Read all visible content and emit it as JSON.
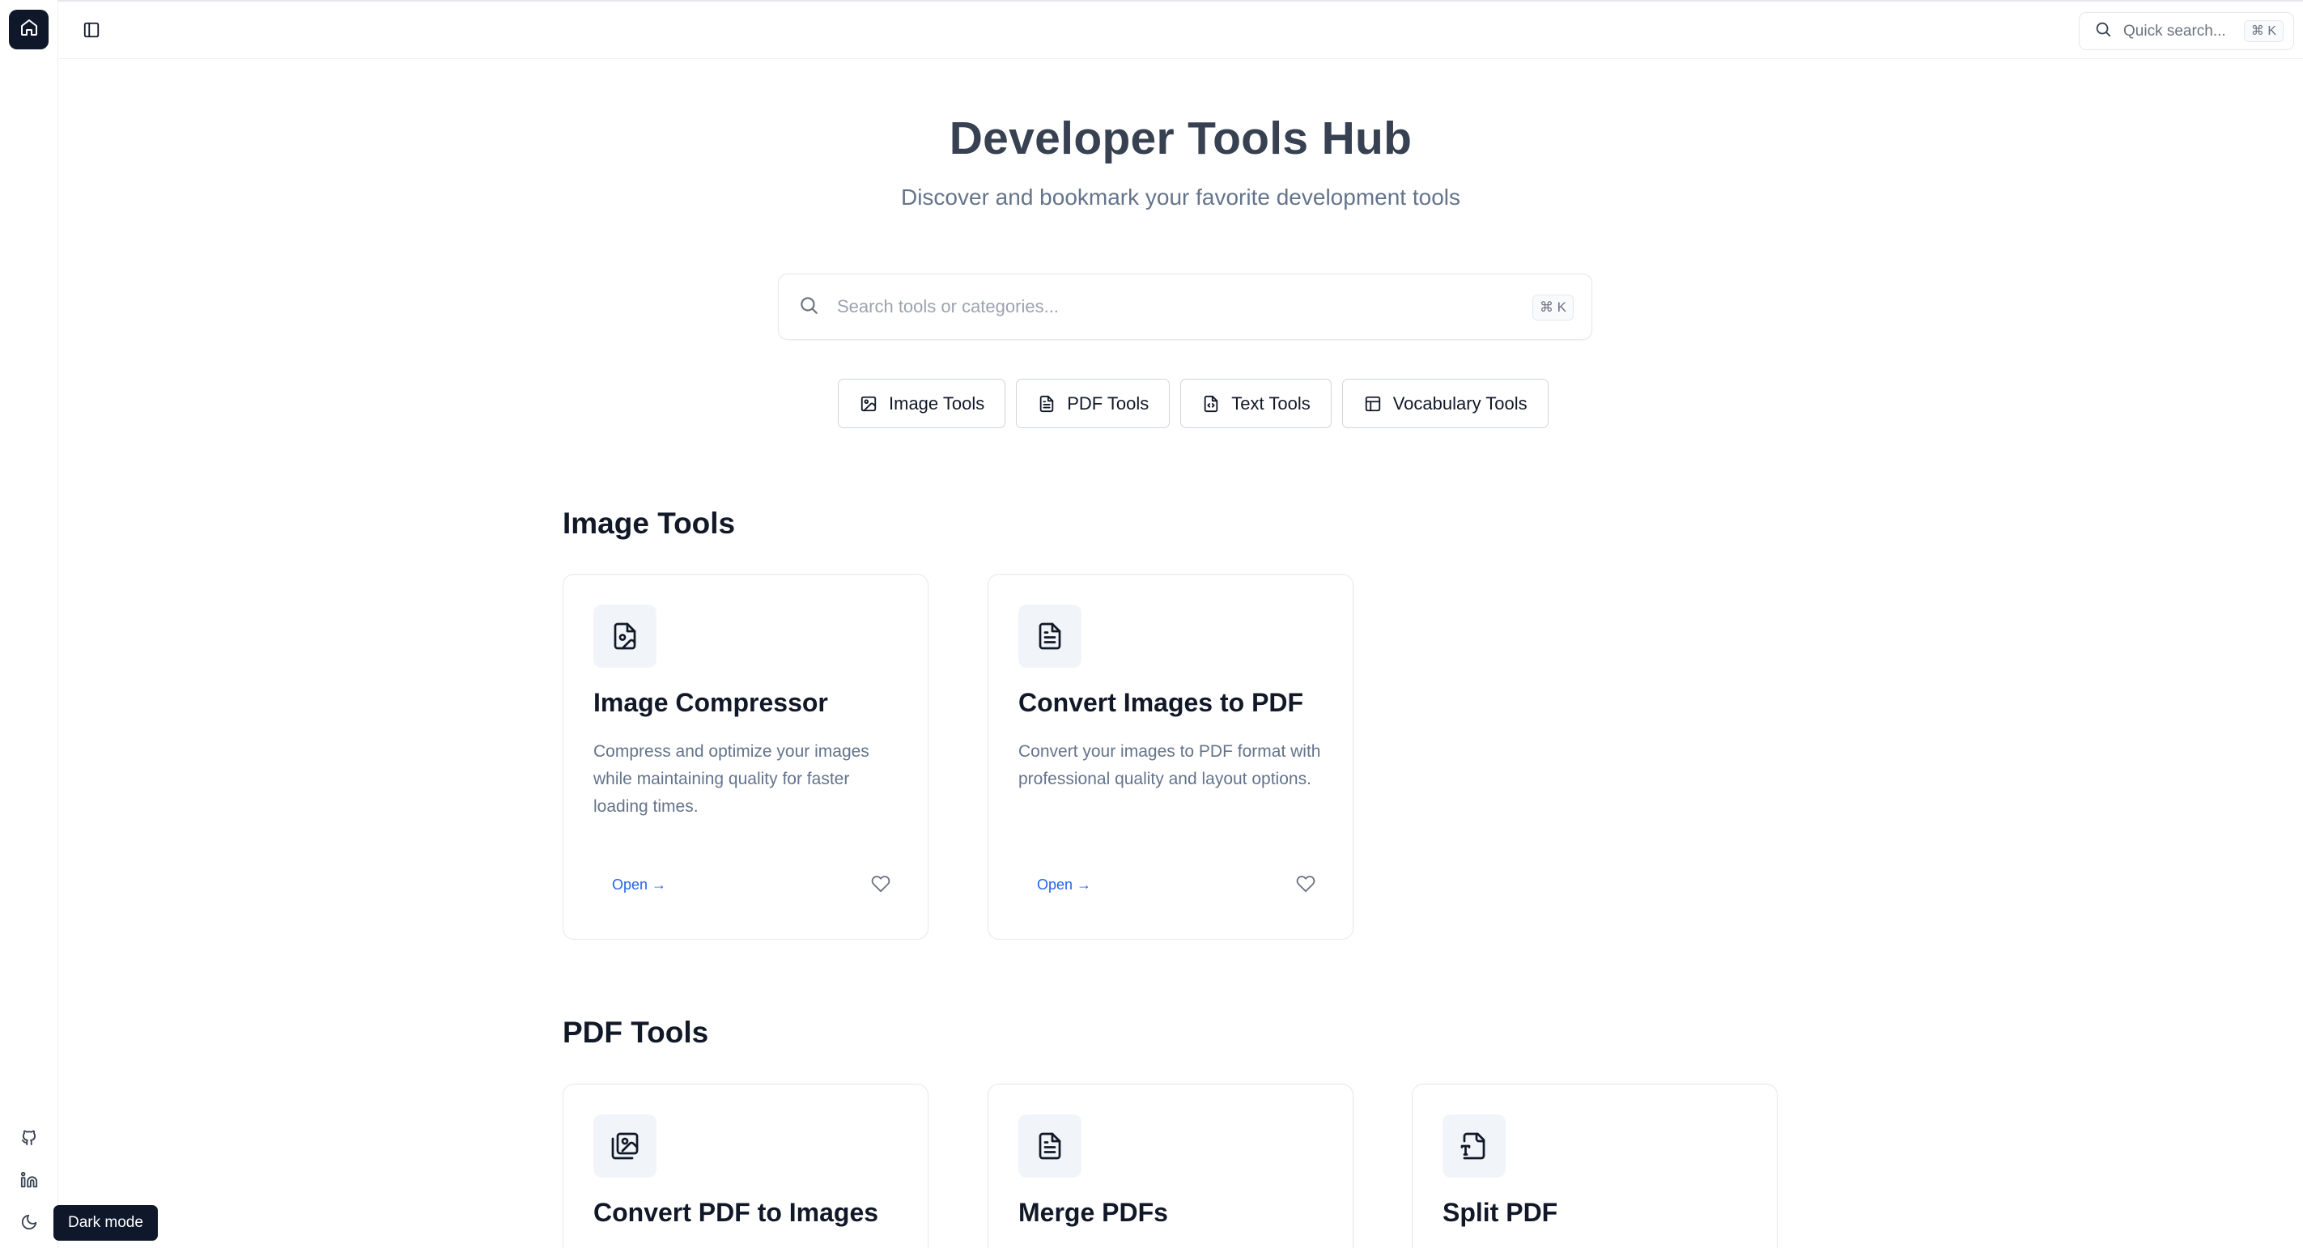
{
  "rail": {
    "home_icon": "home-icon",
    "bottom_icons": [
      "github-icon",
      "linkedin-icon",
      "moon-icon"
    ],
    "tooltip": "Dark mode"
  },
  "topbar": {
    "sidebar_toggle_icon": "sidebar-icon",
    "quick_search_placeholder": "Quick search...",
    "quick_search_shortcut": "⌘ K"
  },
  "hero": {
    "title": "Developer Tools Hub",
    "subtitle": "Discover and bookmark your favorite development tools"
  },
  "search": {
    "placeholder": "Search tools or categories...",
    "shortcut": "⌘ K"
  },
  "categories": [
    {
      "label": "Image Tools",
      "icon": "image-icon"
    },
    {
      "label": "PDF Tools",
      "icon": "file-text-icon"
    },
    {
      "label": "Text Tools",
      "icon": "file-code-icon"
    },
    {
      "label": "Vocabulary Tools",
      "icon": "layout-icon"
    }
  ],
  "sections": [
    {
      "title": "Image Tools",
      "cards": [
        {
          "title": "Image Compressor",
          "description": "Compress and optimize your images while maintaining quality for faster loading times.",
          "open_label": "Open →",
          "icon": "file-image-icon"
        },
        {
          "title": "Convert Images to PDF",
          "description": "Convert your images to PDF format with professional quality and layout options.",
          "open_label": "Open →",
          "icon": "file-text-icon"
        }
      ]
    },
    {
      "title": "PDF Tools",
      "cards": [
        {
          "title": "Convert PDF to Images",
          "icon": "images-icon"
        },
        {
          "title": "Merge PDFs",
          "icon": "file-text-icon"
        },
        {
          "title": "Split PDF",
          "icon": "file-type-icon"
        }
      ]
    }
  ]
}
